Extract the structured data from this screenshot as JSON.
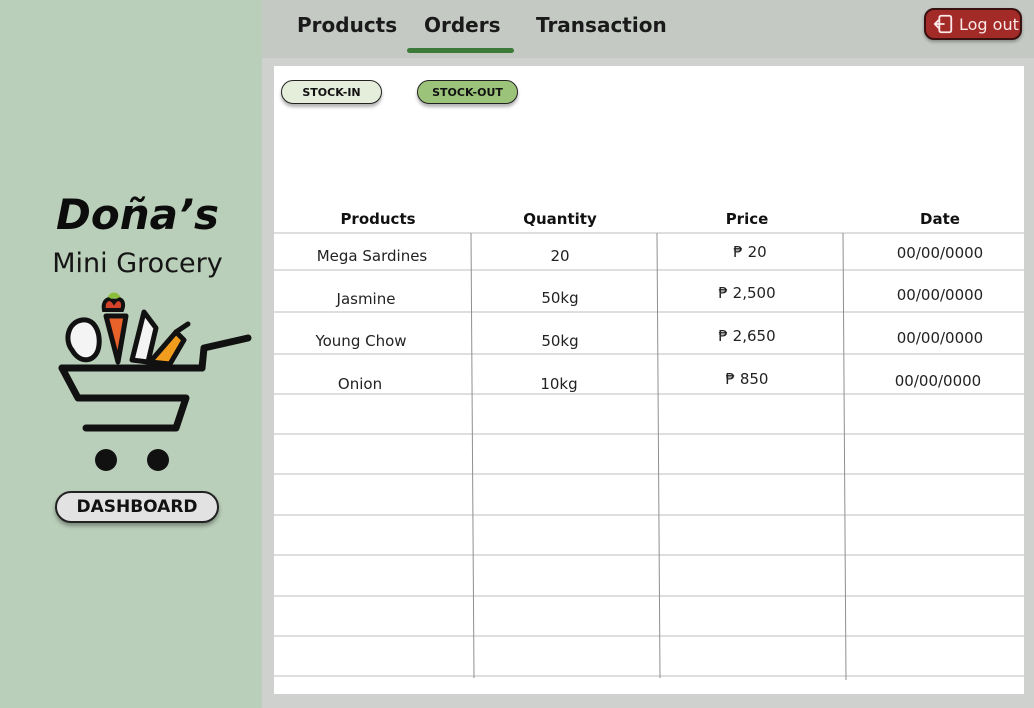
{
  "brand": {
    "name": "Doña’s",
    "subtitle": "Mini Grocery"
  },
  "sidebar": {
    "dashboard_label": "DASHBOARD"
  },
  "nav": {
    "tabs": [
      {
        "label": "Products"
      },
      {
        "label": "Orders",
        "active": true
      },
      {
        "label": "Transaction"
      }
    ],
    "logout_label": "Log out"
  },
  "filters": {
    "stock_in": "STOCK-IN",
    "stock_out": "STOCK-OUT"
  },
  "table": {
    "headers": [
      "Products",
      "Quantity",
      "Price",
      "Date"
    ],
    "rows": [
      [
        "Mega Sardines",
        "20",
        "₱ 20",
        "00/00/0000"
      ],
      [
        "Jasmine",
        "50kg",
        "₱ 2,500",
        "00/00/0000"
      ],
      [
        "Young Chow",
        "50kg",
        "₱ 2,650",
        "00/00/0000"
      ],
      [
        "Onion",
        "10kg",
        "₱ 850",
        "00/00/0000"
      ]
    ]
  },
  "colors": {
    "sidebar": "#bacfba",
    "topbar": "#c4c9c3",
    "active_tab_underline": "#3c7a3a",
    "logout": "#a22a27",
    "stock_in": "#e5eedb",
    "stock_out": "#9cc37a"
  }
}
